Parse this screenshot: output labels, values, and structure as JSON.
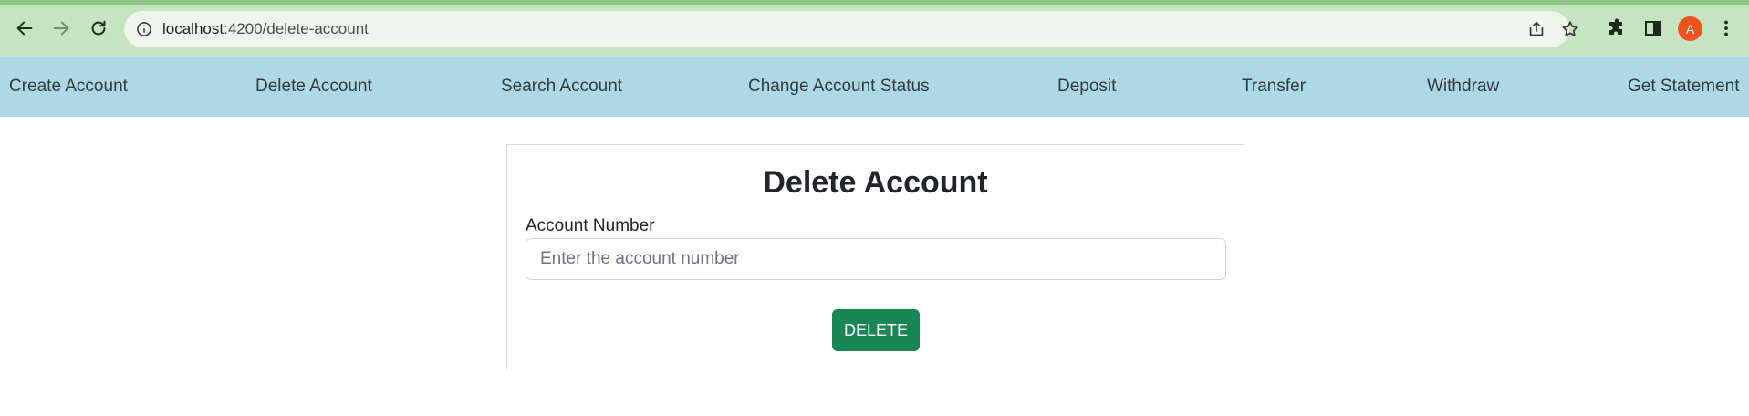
{
  "browser": {
    "url_host": "localhost",
    "url_path": ":4200/delete-account",
    "avatar_initial": "A",
    "icons": [
      "back-arrow-icon",
      "forward-arrow-icon",
      "reload-icon",
      "site-info-icon",
      "share-icon",
      "bookmark-star-icon",
      "extensions-icon",
      "side-panel-icon",
      "more-menu-icon"
    ],
    "colors": {
      "chrome_bg": "#c6e4c1",
      "avatar_bg": "#f0521f"
    }
  },
  "nav": {
    "background": "#add8e6",
    "items": [
      {
        "label": "Create Account"
      },
      {
        "label": "Delete Account"
      },
      {
        "label": "Search Account"
      },
      {
        "label": "Change Account Status"
      },
      {
        "label": "Deposit"
      },
      {
        "label": "Transfer"
      },
      {
        "label": "Withdraw"
      },
      {
        "label": "Get Statement"
      }
    ]
  },
  "form": {
    "title": "Delete Account",
    "account_label": "Account Number",
    "account_value": "",
    "account_placeholder": "Enter the account number",
    "submit_label": "DELETE",
    "submit_color": "#198754"
  }
}
